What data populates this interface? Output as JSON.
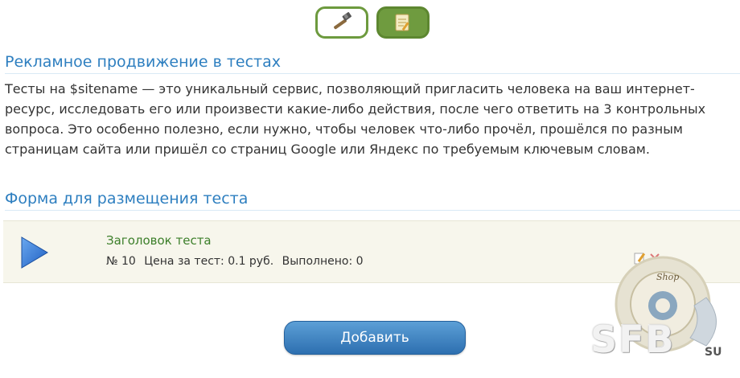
{
  "tabs": [
    {
      "icon": "hammer-icon"
    },
    {
      "icon": "notepad-icon"
    }
  ],
  "section1": {
    "title": "Рекламное продвижение в тестах",
    "description": "Тесты на $sitename — это уникальный сервис, позволяющий пригласить человека на ваш интернет-ресурс, исследовать его или произвести какие-либо действия, после чего ответить на 3 контрольных вопроса. Это особенно полезно, если нужно, чтобы человек что-либо прочёл, прошёлся по разным страницам сайта или пришёл со страниц Google или Яндекс по требуемым ключевым словам."
  },
  "section2": {
    "title": "Форма для размещения теста"
  },
  "test": {
    "title": "Заголовок теста",
    "number": "№ 10",
    "price": "Цена за тест: 0.1 руб.",
    "completed": "Выполнено: 0"
  },
  "add_button": {
    "label": "Добавить"
  },
  "watermark": {
    "text": "SFB",
    "suffix": "SU",
    "shop": "Shop"
  },
  "colors": {
    "accent": "#2e7fc0",
    "tab_green": "#6f9b3f",
    "button_blue": "#2d6fb0",
    "card_bg": "#f7f6ec"
  }
}
